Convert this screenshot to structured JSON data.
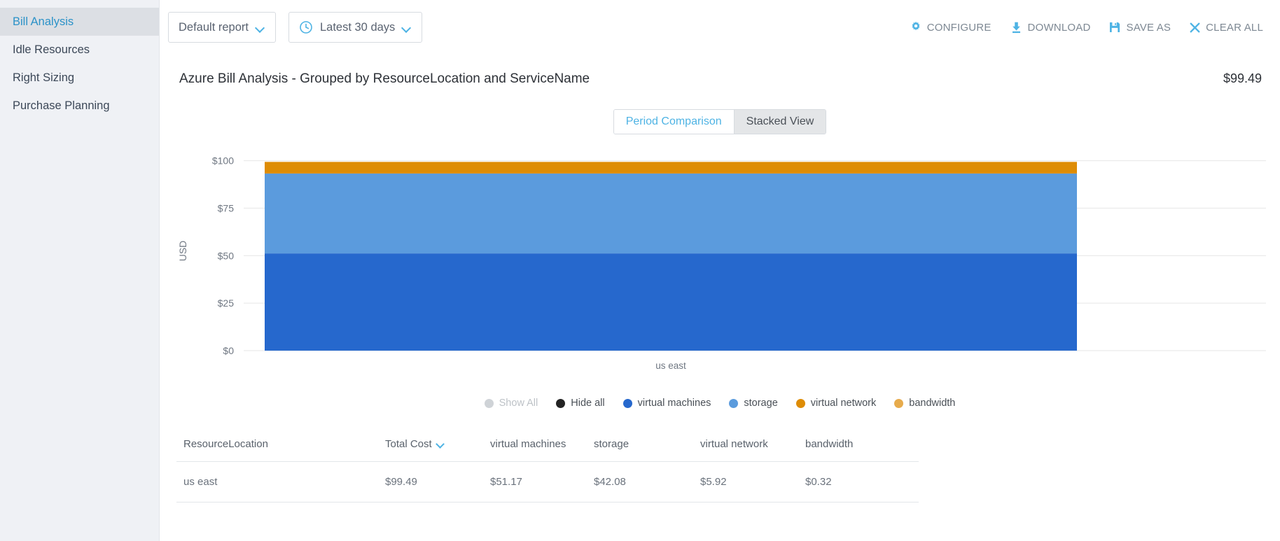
{
  "sidebar": {
    "items": [
      {
        "label": "Bill Analysis",
        "active": true
      },
      {
        "label": "Idle Resources",
        "active": false
      },
      {
        "label": "Right Sizing",
        "active": false
      },
      {
        "label": "Purchase Planning",
        "active": false
      }
    ]
  },
  "toolbar": {
    "report_select": "Default report",
    "date_select": "Latest 30 days",
    "clock_icon": "clock-icon",
    "actions": [
      {
        "label": "CONFIGURE",
        "icon": "gear-icon"
      },
      {
        "label": "DOWNLOAD",
        "icon": "download-icon"
      },
      {
        "label": "SAVE AS",
        "icon": "save-icon"
      },
      {
        "label": "CLEAR ALL",
        "icon": "close-icon"
      }
    ]
  },
  "report": {
    "title": "Azure Bill Analysis - Grouped by ResourceLocation and ServiceName",
    "total": "$99.49"
  },
  "tabs": [
    {
      "label": "Period Comparison",
      "selected": false
    },
    {
      "label": "Stacked View",
      "selected": true
    }
  ],
  "legend": {
    "show_all": "Show All",
    "hide_all": "Hide all",
    "show_all_color": "#cfd3d7",
    "hide_all_color": "#232323",
    "series": [
      {
        "label": "virtual machines",
        "color": "#2668cd"
      },
      {
        "label": "storage",
        "color": "#5b9bdd"
      },
      {
        "label": "virtual network",
        "color": "#de8c05"
      },
      {
        "label": "bandwidth",
        "color": "#e7ab4c"
      }
    ]
  },
  "chart_data": {
    "type": "bar",
    "stacked": true,
    "title": "Azure Bill Analysis - Grouped by ResourceLocation and ServiceName",
    "xlabel": "",
    "ylabel": "USD",
    "categories": [
      "us east"
    ],
    "ytick_labels": [
      "$0",
      "$25",
      "$50",
      "$75",
      "$100"
    ],
    "ytick_values": [
      0,
      25,
      50,
      75,
      100
    ],
    "ylim": [
      0,
      105
    ],
    "grid": true,
    "legend_position": "bottom",
    "series": [
      {
        "name": "virtual machines",
        "color": "#2668cd",
        "values": [
          51.17
        ]
      },
      {
        "name": "storage",
        "color": "#5b9bdd",
        "values": [
          42.08
        ]
      },
      {
        "name": "virtual network",
        "color": "#de8c05",
        "values": [
          5.92
        ]
      },
      {
        "name": "bandwidth",
        "color": "#e7ab4c",
        "values": [
          0.32
        ]
      }
    ],
    "totals": [
      99.49
    ]
  },
  "table": {
    "columns": [
      {
        "label": "ResourceLocation",
        "sorted": false
      },
      {
        "label": "Total Cost",
        "sorted": true
      },
      {
        "label": "virtual machines",
        "sorted": false
      },
      {
        "label": "storage",
        "sorted": false
      },
      {
        "label": "virtual network",
        "sorted": false
      },
      {
        "label": "bandwidth",
        "sorted": false
      }
    ],
    "rows": [
      {
        "location": "us east",
        "total": "$99.49",
        "virtual_machines": "$51.17",
        "storage": "$42.08",
        "virtual_network": "$5.92",
        "bandwidth": "$0.32"
      }
    ]
  }
}
